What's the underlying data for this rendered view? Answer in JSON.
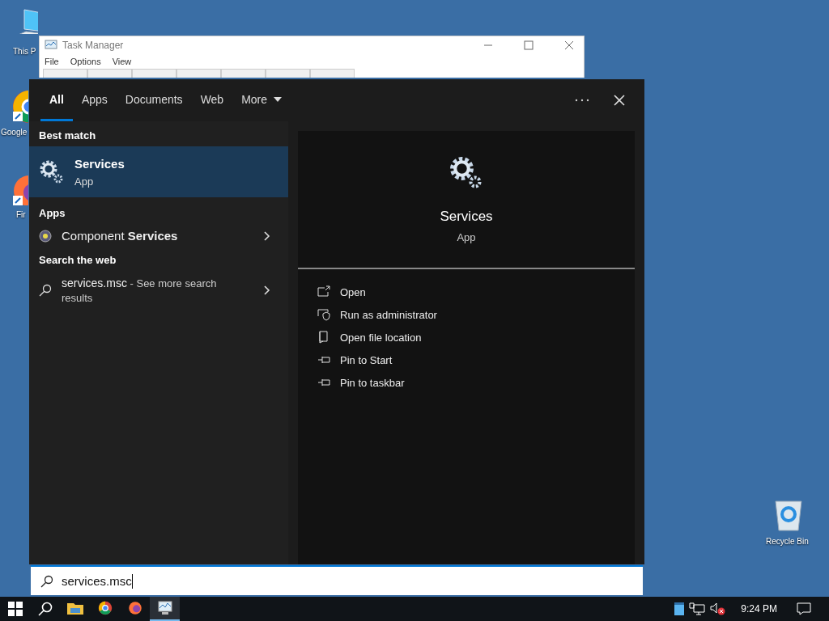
{
  "desktop_icons": [
    {
      "label": "This P",
      "kind": "pc"
    },
    {
      "label": "Google",
      "kind": "chrome"
    },
    {
      "label": "Fir",
      "kind": "firefox"
    },
    {
      "label": "Recycle Bin",
      "kind": "bin"
    }
  ],
  "task_manager": {
    "title": "Task Manager",
    "menu": [
      "File",
      "Options",
      "View"
    ]
  },
  "search": {
    "tabs": [
      {
        "label": "All",
        "selected": true
      },
      {
        "label": "Apps",
        "selected": false
      },
      {
        "label": "Documents",
        "selected": false
      },
      {
        "label": "Web",
        "selected": false
      }
    ],
    "more": "More",
    "best_match_heading": "Best match",
    "best_match": {
      "name": "Services",
      "type": "App",
      "selected": true
    },
    "apps_heading": "Apps",
    "apps": [
      {
        "name": "Component **Services**"
      }
    ],
    "web_heading": "Search the web",
    "web": [
      {
        "query": "services.msc",
        "suffix": " - See more search results"
      }
    ],
    "preview": {
      "name": "Services",
      "type": "App",
      "actions": [
        {
          "label": "Open",
          "kind": "open"
        },
        {
          "label": "Run as administrator",
          "kind": "admin"
        },
        {
          "label": "Open file location",
          "kind": "folder"
        },
        {
          "label": "Pin to Start",
          "kind": "pin"
        },
        {
          "label": "Pin to taskbar",
          "kind": "pin"
        }
      ]
    },
    "query": "services.msc"
  },
  "taskbar": {
    "apps": [
      {
        "kind": "explorer",
        "active": false
      },
      {
        "kind": "chrome",
        "active": false
      },
      {
        "kind": "firefox",
        "active": false
      },
      {
        "kind": "taskmgr",
        "active": true
      }
    ],
    "clock": "9:24 PM"
  }
}
